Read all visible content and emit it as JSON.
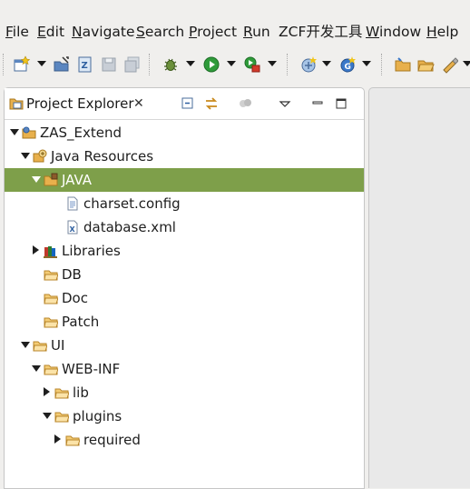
{
  "menubar": {
    "items": [
      {
        "mnemonic": "F",
        "rest": "ile"
      },
      {
        "mnemonic": "E",
        "rest": "dit"
      },
      {
        "mnemonic": "N",
        "rest": "avigate"
      },
      {
        "mnemonic": "S",
        "rest": "earch"
      },
      {
        "mnemonic": "P",
        "rest": "roject"
      },
      {
        "mnemonic": "R",
        "rest": "un"
      },
      {
        "mnemonic": "",
        "rest": "ZCF开发工具"
      },
      {
        "mnemonic": "W",
        "rest": "indow"
      },
      {
        "mnemonic": "H",
        "rest": "elp"
      }
    ]
  },
  "view": {
    "title": "Project Explorer",
    "close_glyph": "✕"
  },
  "tree": [
    {
      "label": "ZAS_Extend",
      "icon": "project-icon",
      "state": "open",
      "level": 0
    },
    {
      "label": "Java Resources",
      "icon": "java-resources-icon",
      "state": "open",
      "level": 1
    },
    {
      "label": "JAVA",
      "icon": "source-folder-icon",
      "state": "open",
      "level": 2,
      "selected": true
    },
    {
      "label": "charset.config",
      "icon": "file-icon",
      "state": "leaf",
      "level": 4
    },
    {
      "label": "database.xml",
      "icon": "xml-file-icon",
      "state": "leaf",
      "level": 4
    },
    {
      "label": "Libraries",
      "icon": "libraries-icon",
      "state": "closed",
      "level": 2
    },
    {
      "label": "DB",
      "icon": "folder-icon",
      "state": "leaf",
      "level": 2
    },
    {
      "label": "Doc",
      "icon": "folder-icon",
      "state": "leaf",
      "level": 2
    },
    {
      "label": "Patch",
      "icon": "folder-icon",
      "state": "leaf",
      "level": 2
    },
    {
      "label": "UI",
      "icon": "folder-icon",
      "state": "open",
      "level": 1
    },
    {
      "label": "WEB-INF",
      "icon": "folder-icon",
      "state": "open",
      "level": 2
    },
    {
      "label": "lib",
      "icon": "folder-icon",
      "state": "closed",
      "level": 3
    },
    {
      "label": "plugins",
      "icon": "folder-icon",
      "state": "open",
      "level": 3
    },
    {
      "label": "required",
      "icon": "folder-icon",
      "state": "closed",
      "level": 4
    }
  ],
  "colors": {
    "selection": "#7e9f4a",
    "folder": "#e8b04c"
  }
}
